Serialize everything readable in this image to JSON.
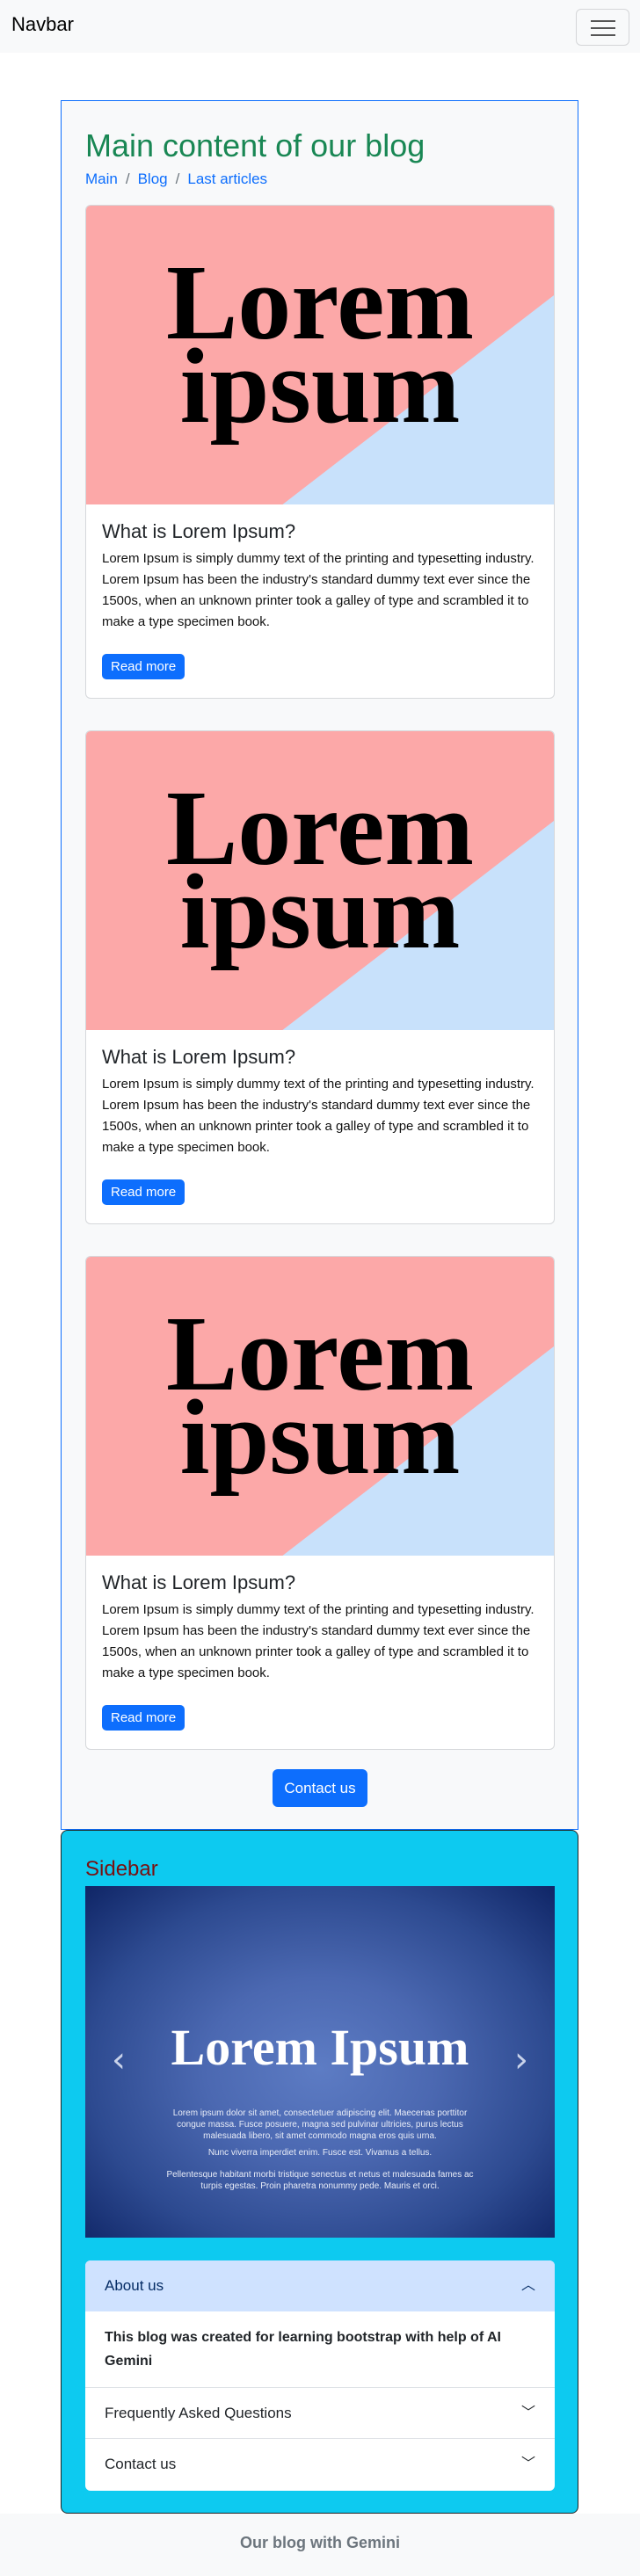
{
  "navbar": {
    "brand": "Navbar",
    "toggler_icon": "hamburger-icon"
  },
  "main": {
    "title": "Main content of our blog",
    "breadcrumb": [
      "Main",
      "Blog",
      "Last articles"
    ],
    "cards": [
      {
        "image_line1": "Lorem",
        "image_line2": "ipsum",
        "title": "What is Lorem Ipsum?",
        "text": "Lorem Ipsum is simply dummy text of the printing and typesetting industry. Lorem Ipsum has been the industry's standard dummy text ever since the 1500s, when an unknown printer took a galley of type and scrambled it to make a type specimen book.",
        "button": "Read more"
      },
      {
        "image_line1": "Lorem",
        "image_line2": "ipsum",
        "title": "What is Lorem Ipsum?",
        "text": "Lorem Ipsum is simply dummy text of the printing and typesetting industry. Lorem Ipsum has been the industry's standard dummy text ever since the 1500s, when an unknown printer took a galley of type and scrambled it to make a type specimen book.",
        "button": "Read more"
      },
      {
        "image_line1": "Lorem",
        "image_line2": "ipsum",
        "title": "What is Lorem Ipsum?",
        "text": "Lorem Ipsum is simply dummy text of the printing and typesetting industry. Lorem Ipsum has been the industry's standard dummy text ever since the 1500s, when an unknown printer took a galley of type and scrambled it to make a type specimen book.",
        "button": "Read more"
      }
    ],
    "contact_button": "Contact us"
  },
  "sidebar": {
    "title": "Sidebar",
    "carousel": {
      "title": "Lorem Ipsum",
      "para1": "Lorem ipsum dolor sit amet, consectetuer adipiscing elit. Maecenas porttitor congue massa. Fusce posuere, magna sed pulvinar ultricies, purus lectus malesuada libero, sit amet commodo magna eros quis urna.",
      "para2": "Nunc viverra imperdiet enim. Fusce est. Vivamus a tellus.",
      "para3": "Pellentesque habitant morbi tristique senectus et netus et malesuada fames ac turpis egestas. Proin pharetra nonummy pede. Mauris et orci.",
      "prev": "‹",
      "next": "›",
      "active_slide": 2,
      "slide_count": 3
    },
    "accordion": [
      {
        "label": "About us",
        "expanded": true,
        "body": "This blog was created for learning bootstrap with help of AI Gemini"
      },
      {
        "label": "Frequently Asked Questions",
        "expanded": false
      },
      {
        "label": "Contact us",
        "expanded": false
      }
    ]
  },
  "footer": {
    "text": "Our blog with Gemini"
  },
  "colors": {
    "primary": "#0d6efd",
    "title_green": "#198754",
    "sidebar_bg": "#0dcaf0",
    "sidebar_title": "#7a1010",
    "accordion_active": "#cfe2ff"
  }
}
